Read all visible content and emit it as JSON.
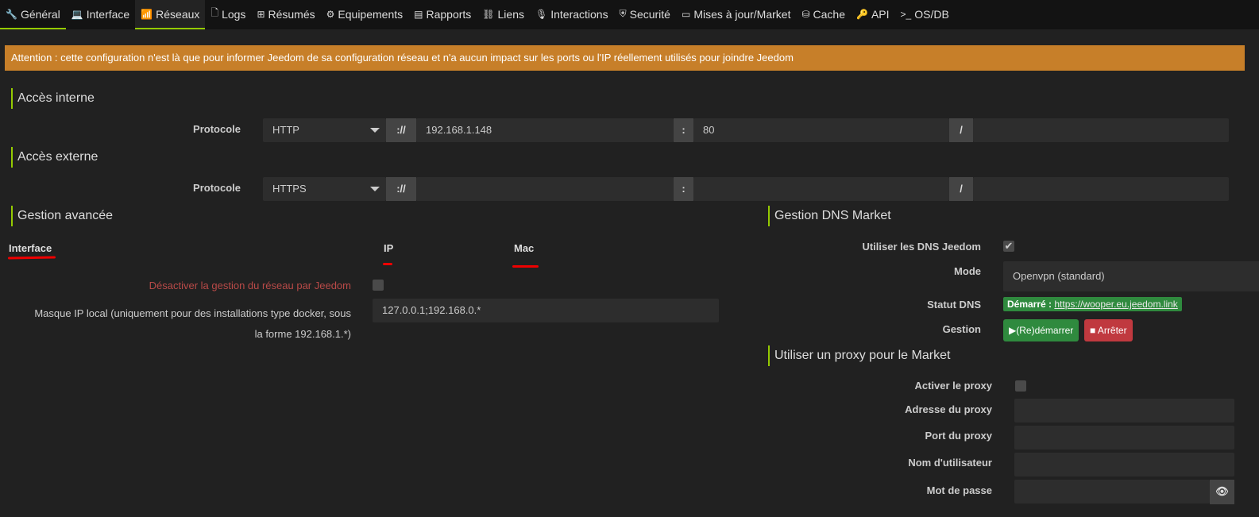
{
  "tabs": [
    {
      "label": "Général",
      "icon": "wrench-icon",
      "glyph": "🔧"
    },
    {
      "label": "Interface",
      "icon": "laptop-icon",
      "glyph": "💻"
    },
    {
      "label": "Réseaux",
      "icon": "rss-icon",
      "glyph": "📶"
    },
    {
      "label": "Logs",
      "icon": "file-icon",
      "glyph": "🗋"
    },
    {
      "label": "Résumés",
      "icon": "table-icon",
      "glyph": "⊞"
    },
    {
      "label": "Equipements",
      "icon": "cog-icon",
      "glyph": "⚙"
    },
    {
      "label": "Rapports",
      "icon": "list-icon",
      "glyph": "▤"
    },
    {
      "label": "Liens",
      "icon": "sitemap-icon",
      "glyph": "⛓"
    },
    {
      "label": "Interactions",
      "icon": "microphone-icon",
      "glyph": "🎙"
    },
    {
      "label": "Securité",
      "icon": "shield-icon",
      "glyph": "⛨"
    },
    {
      "label": "Mises à jour/Market",
      "icon": "credit-card-icon",
      "glyph": "▭"
    },
    {
      "label": "Cache",
      "icon": "hdd-icon",
      "glyph": "⛁"
    },
    {
      "label": "API",
      "icon": "key-icon",
      "glyph": "🔑"
    },
    {
      "label": "OS/DB",
      "icon": "terminal-icon",
      "glyph": ">_"
    }
  ],
  "warning": "Attention : cette configuration n'est là que pour informer Jeedom de sa configuration réseau et n'a aucun impact sur les ports ou l'IP réellement utilisés pour joindre Jeedom",
  "internal": {
    "title": "Accès interne",
    "protocol_label": "Protocole",
    "protocol": "HTTP",
    "sep1": "://",
    "host": "192.168.1.148",
    "sep2": ":",
    "port": "80",
    "sep3": "/",
    "path": ""
  },
  "external": {
    "title": "Accès externe",
    "protocol_label": "Protocole",
    "protocol": "HTTPS",
    "sep1": "://",
    "host": "",
    "sep2": ":",
    "port": "",
    "sep3": "/",
    "path": ""
  },
  "advanced": {
    "title": "Gestion avancée",
    "col_interface": "Interface",
    "col_ip": "IP",
    "col_mac": "Mac",
    "disable_label": "Désactiver la gestion du réseau par Jeedom",
    "mask_label_1": "Masque IP local (uniquement pour des installations type docker, sous",
    "mask_label_2": "la forme 192.168.1.*)",
    "mask_value": "127.0.0.1;192.168.0.*"
  },
  "dns": {
    "title": "Gestion DNS Market",
    "use_label": "Utiliser les DNS Jeedom",
    "mode_label": "Mode",
    "mode": "Openvpn (standard)",
    "status_label": "Statut DNS",
    "status_prefix": "Démarré :",
    "status_link": "https://wooper.eu.jeedom.link",
    "manage_label": "Gestion",
    "restart": "(Re)démarrer",
    "stop": "Arrêter"
  },
  "proxy": {
    "title": "Utiliser un proxy pour le Market",
    "enable_label": "Activer le proxy",
    "address_label": "Adresse du proxy",
    "port_label": "Port du proxy",
    "user_label": "Nom d'utilisateur",
    "password_label": "Mot de passe"
  }
}
